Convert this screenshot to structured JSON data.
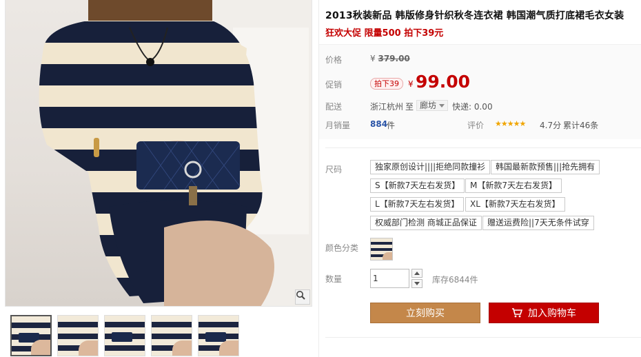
{
  "product": {
    "title": "2013秋装新品 韩版修身针织秋冬连衣裙 韩国潮气质打底裙毛衣女装",
    "promo_line": "狂欢大促 限量500 拍下39元"
  },
  "price": {
    "label": "价格",
    "currency_symbol": "¥",
    "original": "379.00"
  },
  "promotion": {
    "label": "促销",
    "tag": "拍下39",
    "currency_symbol": "¥",
    "price": "99.00"
  },
  "shipping": {
    "label": "配送",
    "from": "浙江杭州",
    "to_word": "至",
    "destination": "廊坊",
    "fee": "快递: 0.00"
  },
  "sales": {
    "label": "月销量",
    "count": "884",
    "unit": "件",
    "rating_label": "评价",
    "rating_score": "4.7分",
    "review_count": "累计46条",
    "rating_value": 4.7
  },
  "size": {
    "label": "尺码",
    "options": [
      "独家原创设计||||拒绝同款撞衫",
      "韩国最新款预售|||抢先拥有",
      "S【新款7天左右发货】",
      "M【新款7天左右发货】",
      "L【新款7天左右发货】",
      "XL【新款7天左右发货】",
      "权威部门检测 商城正品保证",
      "赠送运费险||7天无条件试穿"
    ]
  },
  "color": {
    "label": "颜色分类"
  },
  "quantity": {
    "label": "数量",
    "value": "1",
    "stock": "库存6844件"
  },
  "actions": {
    "buy_now": "立刻购买",
    "add_to_cart": "加入购物车"
  },
  "colors": {
    "accent_red": "#c40000",
    "buy_button": "#c4874a",
    "sales_blue": "#2953a6"
  }
}
